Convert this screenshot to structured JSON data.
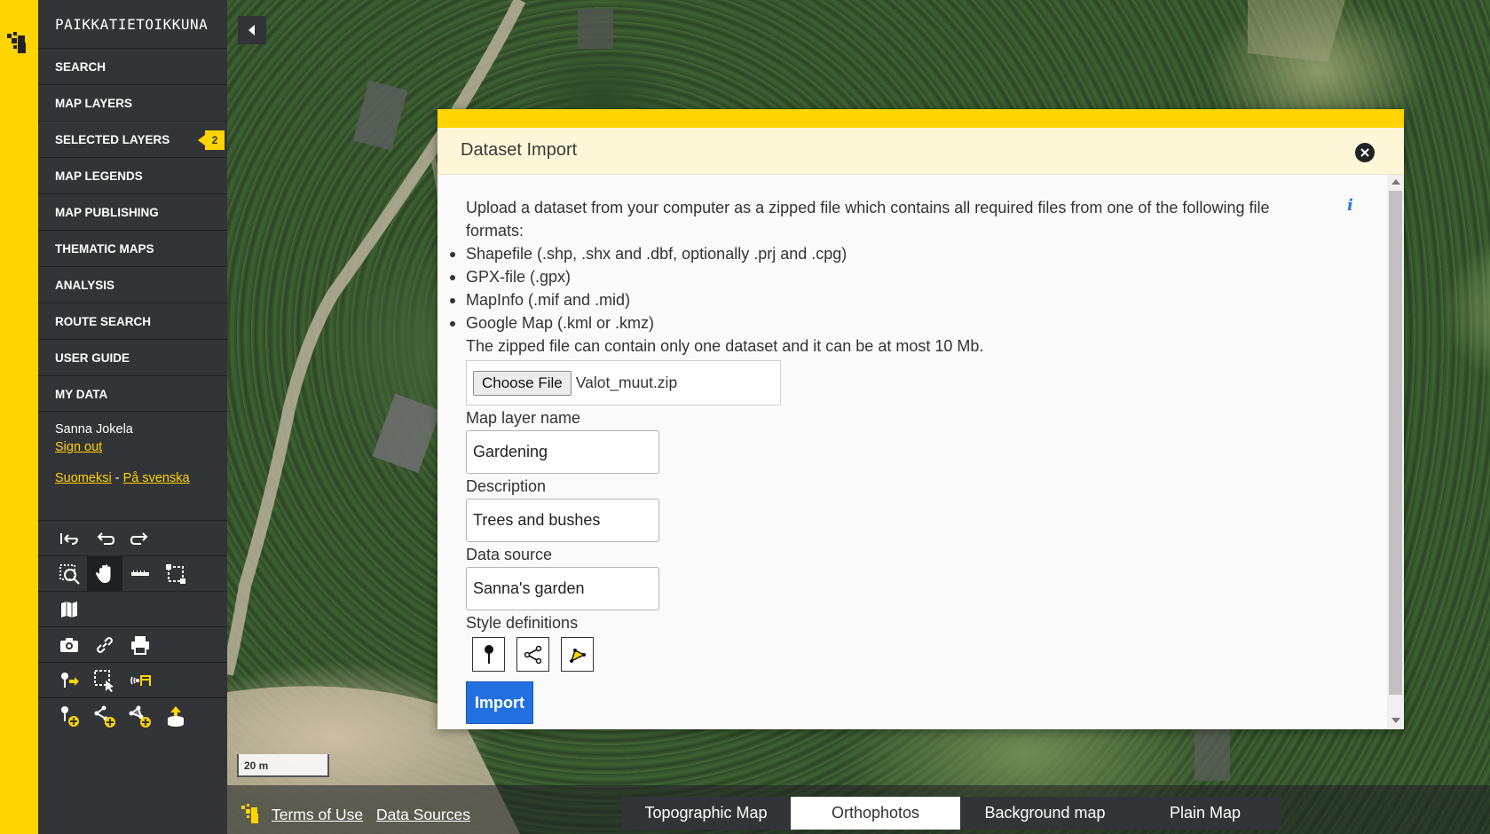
{
  "app": {
    "title": "PAIKKATIETOIKKUNA"
  },
  "sidebar": {
    "items": [
      {
        "label": "SEARCH"
      },
      {
        "label": "MAP LAYERS"
      },
      {
        "label": "SELECTED LAYERS",
        "badge": "2"
      },
      {
        "label": "MAP LEGENDS"
      },
      {
        "label": "MAP PUBLISHING"
      },
      {
        "label": "THEMATIC MAPS"
      },
      {
        "label": "ANALYSIS"
      },
      {
        "label": "ROUTE SEARCH"
      },
      {
        "label": "USER GUIDE"
      },
      {
        "label": "MY DATA"
      }
    ],
    "user": {
      "name": "Sanna Jokela",
      "sign_out": "Sign out"
    },
    "languages": {
      "finnish": "Suomeksi",
      "separator": "-",
      "swedish": "På svenska"
    },
    "tools": [
      [
        "reset-view-icon",
        "undo-icon",
        "redo-icon"
      ],
      [
        "zoom-box-icon",
        "pan-hand-icon",
        "measure-line-icon",
        "measure-area-icon"
      ],
      [
        "map-icon"
      ],
      [
        "camera-icon",
        "link-icon",
        "print-icon"
      ],
      [
        "feature-info-icon",
        "select-features-icon",
        "wfs-icon"
      ],
      [
        "add-point-icon",
        "add-line-icon",
        "add-area-icon",
        "import-dataset-icon"
      ]
    ]
  },
  "map": {
    "scale": "20 m"
  },
  "footer": {
    "terms": "Terms of Use",
    "sources": "Data Sources",
    "basemaps": [
      "Topographic Map",
      "Orthophotos",
      "Background map",
      "Plain Map"
    ],
    "selected_basemap": "Orthophotos"
  },
  "dialog": {
    "title": "Dataset Import",
    "info_icon": "i",
    "intro": "Upload a dataset from your computer as a zipped file which contains all required files from one of the following file formats:",
    "formats": [
      "Shapefile (.shp, .shx and .dbf, optionally .prj and .cpg)",
      "GPX-file (.gpx)",
      "MapInfo (.mif and .mid)",
      "Google Map (.kml or .kmz)"
    ],
    "size_note": "The zipped file can contain only one dataset and it can be at most 10 Mb.",
    "choose_file_label": "Choose File",
    "file_name": "Valot_muut.zip",
    "layer_name_label": "Map layer name",
    "layer_name_value": "Gardening",
    "description_label": "Description",
    "description_value": "Trees and bushes",
    "source_label": "Data source",
    "source_value": "Sanna's garden",
    "style_label": "Style definitions",
    "style_buttons": [
      "point-style-icon",
      "line-style-icon",
      "area-style-icon"
    ],
    "import_label": "Import"
  },
  "colors": {
    "brand_yellow": "#ffd400",
    "sidebar_bg": "#333438",
    "primary_button": "#2270e0"
  }
}
